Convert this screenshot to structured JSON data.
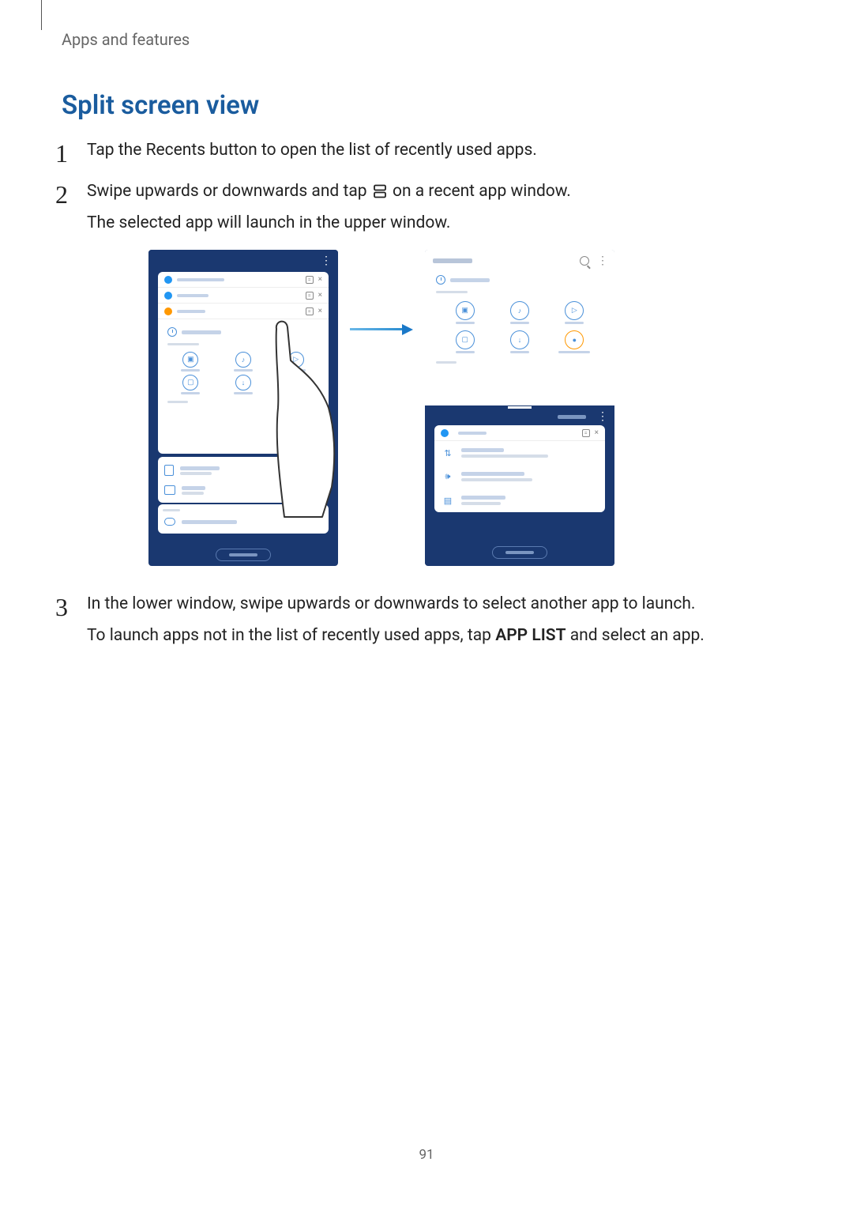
{
  "header": "Apps and features",
  "section_title": "Split screen view",
  "steps": {
    "s1_num": "1",
    "s1_text": "Tap the Recents button to open the list of recently used apps.",
    "s2_num": "2",
    "s2_text_before": "Swipe upwards or downwards and tap ",
    "s2_text_after": " on a recent app window.",
    "s2_line2": "The selected app will launch in the upper window.",
    "s3_num": "3",
    "s3_text": "In the lower window, swipe upwards or downwards to select another app to launch.",
    "s3_line2_before": "To launch apps not in the list of recently used apps, tap ",
    "s3_line2_bold": "APP LIST",
    "s3_line2_after": " and select an app."
  },
  "page_number": "91"
}
